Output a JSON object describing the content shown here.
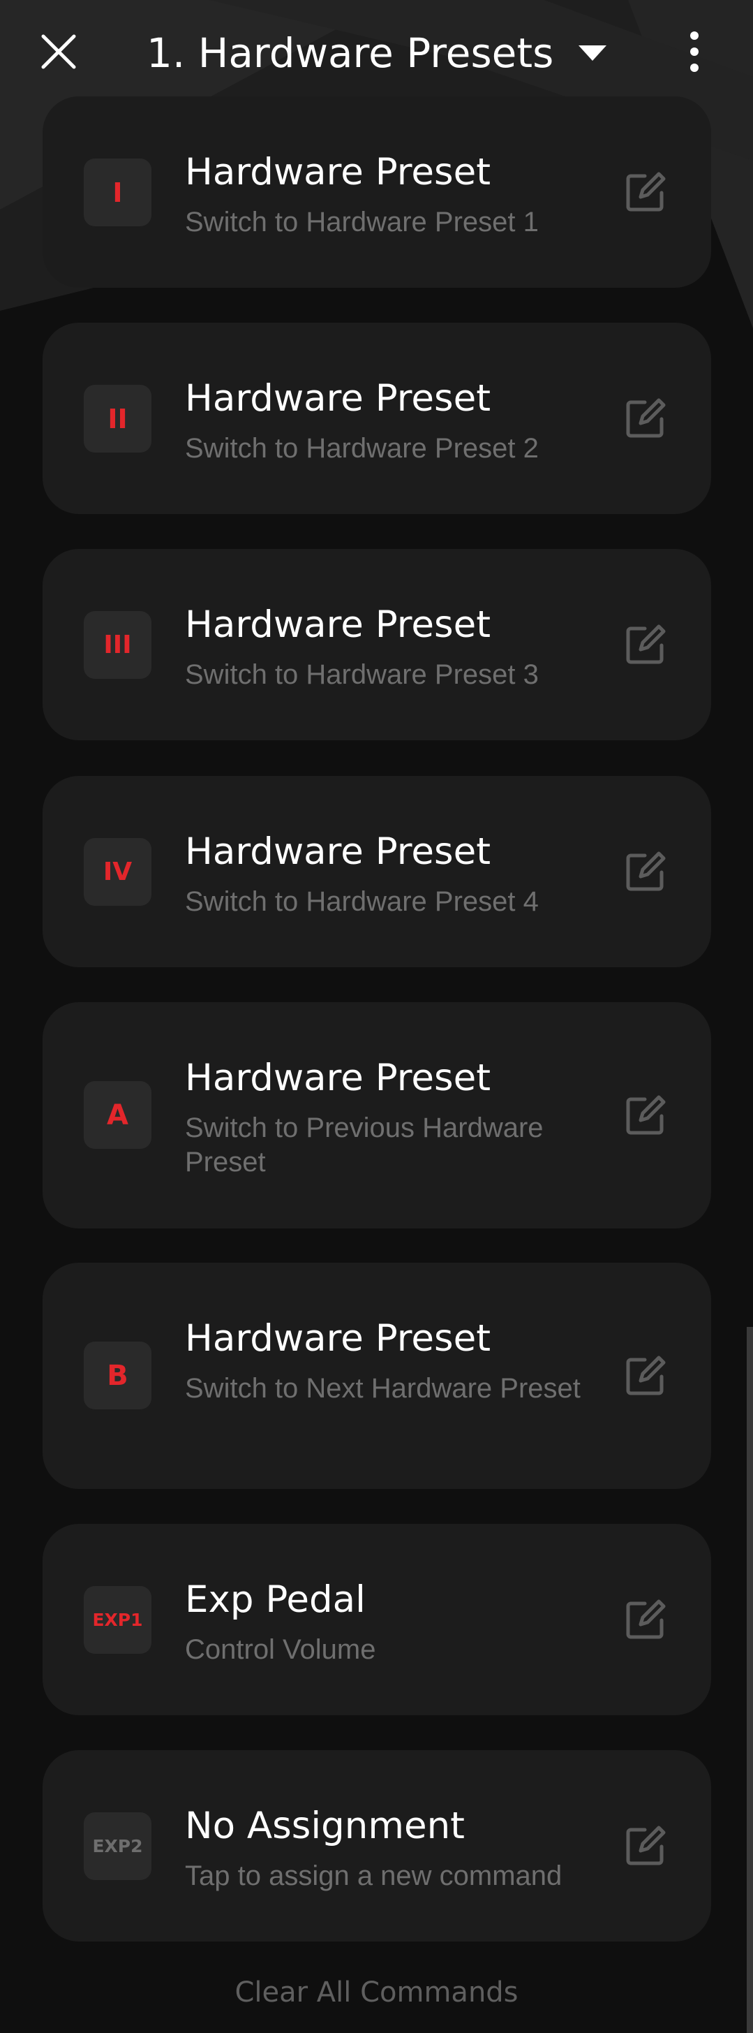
{
  "header": {
    "title": "1. Hardware Presets",
    "close_icon": "close-icon",
    "dropdown_icon": "caret-down-icon",
    "menu_icon": "more-vertical-icon"
  },
  "colors": {
    "accent": "#e3262b",
    "card": "#1c1c1c",
    "badge": "#2a2a2a",
    "subtext": "#6f6f6f"
  },
  "commands": [
    {
      "badge": "I",
      "title": "Hardware Preset",
      "subtitle": "Switch to Hardware Preset 1"
    },
    {
      "badge": "II",
      "title": "Hardware Preset",
      "subtitle": "Switch to Hardware Preset 2"
    },
    {
      "badge": "III",
      "title": "Hardware Preset",
      "subtitle": "Switch to Hardware Preset 3"
    },
    {
      "badge": "IV",
      "title": "Hardware Preset",
      "subtitle": "Switch to Hardware Preset 4"
    },
    {
      "badge": "A",
      "title": "Hardware Preset",
      "subtitle": "Switch to Previous Hardware Preset"
    },
    {
      "badge": "B",
      "title": "Hardware Preset",
      "subtitle": "Switch to Next Hardware Preset"
    },
    {
      "badge": "EXP1",
      "title": "Exp Pedal",
      "subtitle": "Control Volume"
    },
    {
      "badge": "EXP2",
      "title": "No Assignment",
      "subtitle": "Tap to assign a new command"
    }
  ],
  "edit_icon": "edit-icon",
  "footer": {
    "clear_label": "Clear All Commands"
  }
}
